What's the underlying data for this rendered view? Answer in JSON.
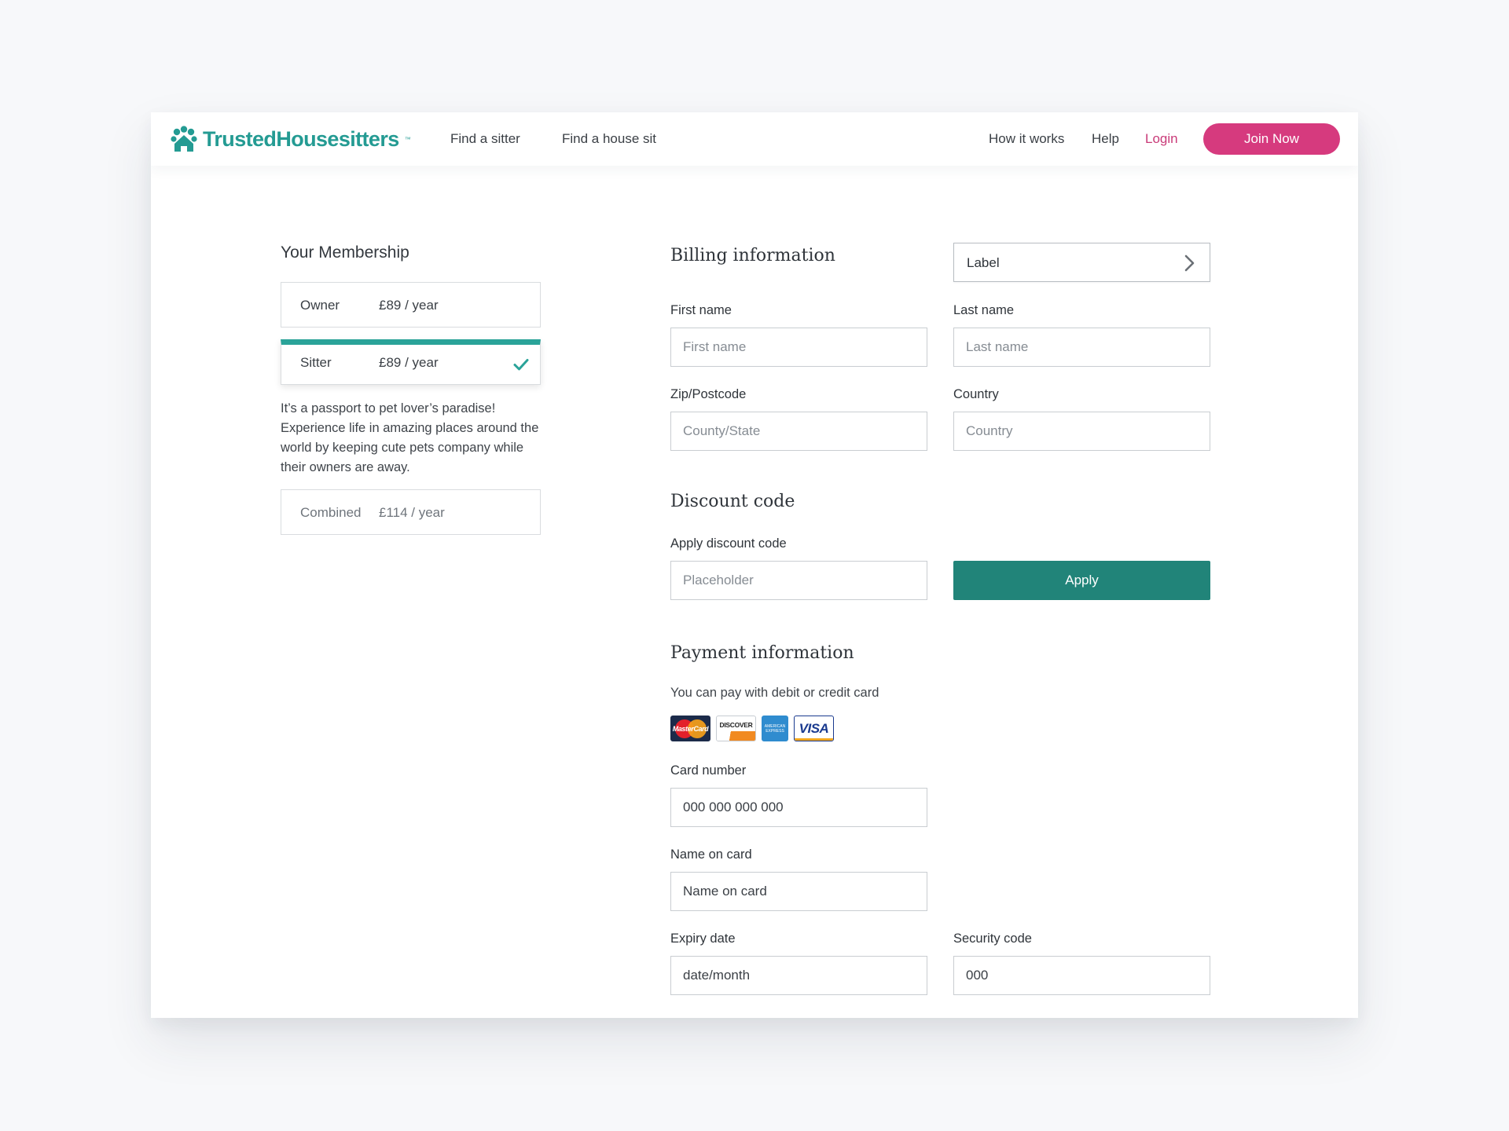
{
  "header": {
    "logo_text": "TrustedHousesitters",
    "logo_tm": "™",
    "nav_left": [
      "Find a sitter",
      "Find a house sit"
    ],
    "nav_right": [
      "How it works",
      "Help"
    ],
    "login": "Login",
    "join": "Join Now"
  },
  "membership": {
    "title": "Your Membership",
    "plans": [
      {
        "name": "Owner",
        "price": "£89 / year"
      },
      {
        "name": "Sitter",
        "price": "£89 / year",
        "selected": true
      },
      {
        "name": "Combined",
        "price": "£114 / year"
      }
    ],
    "description": "It’s a passport to pet lover’s paradise! Experience life in amazing places around the world by keeping cute pets company while their owners are away."
  },
  "billing": {
    "title": "Billing information",
    "label_select": "Label",
    "first_name": {
      "label": "First name",
      "placeholder": "First name"
    },
    "last_name": {
      "label": "Last name",
      "placeholder": "Last name"
    },
    "zip": {
      "label": "Zip/Postcode",
      "placeholder": "County/State"
    },
    "country": {
      "label": "Country",
      "placeholder": "Country"
    }
  },
  "discount": {
    "title": "Discount code",
    "label": "Apply discount code",
    "placeholder": "Placeholder",
    "apply": "Apply"
  },
  "payment": {
    "title": "Payment information",
    "note": "You can pay with debit or credit card",
    "cards": [
      "MasterCard",
      "DISCOVER",
      "AMERICAN EXPRESS",
      "VISA"
    ],
    "card_number": {
      "label": "Card number",
      "value": "000 000 000 000"
    },
    "name_on_card": {
      "label": "Name on card",
      "value": "Name on card"
    },
    "expiry": {
      "label": "Expiry date",
      "value": "date/month"
    },
    "security": {
      "label": "Security code",
      "value": "000"
    }
  },
  "colors": {
    "brand_teal": "#249b93",
    "apply_teal": "#218479",
    "join_pink": "#d63a7e",
    "login_pink": "#c93a78"
  }
}
